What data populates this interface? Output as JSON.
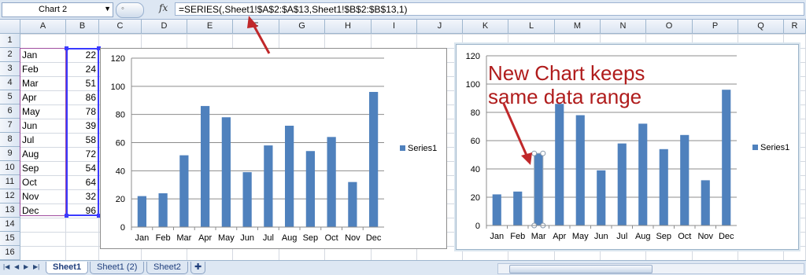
{
  "formula_bar": {
    "name_box": "Chart 2",
    "fx_icon": "fx",
    "formula": "=SERIES(,Sheet1!$A$2:$A$13,Sheet1!$B$2:$B$13,1)"
  },
  "columns": [
    "A",
    "B",
    "C",
    "D",
    "E",
    "F",
    "G",
    "H",
    "I",
    "J",
    "K",
    "L",
    "M",
    "N",
    "O",
    "P",
    "Q",
    "R"
  ],
  "rows": [
    "1",
    "2",
    "3",
    "4",
    "5",
    "6",
    "7",
    "8",
    "9",
    "10",
    "11",
    "12",
    "13",
    "14",
    "15",
    "16"
  ],
  "data": [
    {
      "month": "Jan",
      "value": "22"
    },
    {
      "month": "Feb",
      "value": "24"
    },
    {
      "month": "Mar",
      "value": "51"
    },
    {
      "month": "Apr",
      "value": "86"
    },
    {
      "month": "May",
      "value": "78"
    },
    {
      "month": "Jun",
      "value": "39"
    },
    {
      "month": "Jul",
      "value": "58"
    },
    {
      "month": "Aug",
      "value": "72"
    },
    {
      "month": "Sep",
      "value": "54"
    },
    {
      "month": "Oct",
      "value": "64"
    },
    {
      "month": "Nov",
      "value": "32"
    },
    {
      "month": "Dec",
      "value": "96"
    }
  ],
  "annotation": "New Chart keeps\nsame data range",
  "sheet_tabs": [
    "Sheet1",
    "Sheet1 (2)",
    "Sheet2"
  ],
  "active_tab": "Sheet1",
  "colors": {
    "bar": "#4f81bd",
    "annotation": "#b01c1c",
    "selection_border": "#3a3aff"
  },
  "chart_data": [
    {
      "type": "bar",
      "categories": [
        "Jan",
        "Feb",
        "Mar",
        "Apr",
        "May",
        "Jun",
        "Jul",
        "Aug",
        "Sep",
        "Oct",
        "Nov",
        "Dec"
      ],
      "series": [
        {
          "name": "Series1",
          "values": [
            22,
            24,
            51,
            86,
            78,
            39,
            58,
            72,
            54,
            64,
            32,
            96
          ]
        }
      ],
      "ylim": [
        0,
        120
      ],
      "yticks": [
        "0",
        "20",
        "40",
        "60",
        "80",
        "100",
        "120"
      ],
      "grid": true,
      "legend": "right"
    },
    {
      "type": "bar",
      "categories": [
        "Jan",
        "Feb",
        "Mar",
        "Apr",
        "May",
        "Jun",
        "Jul",
        "Aug",
        "Sep",
        "Oct",
        "Nov",
        "Dec"
      ],
      "series": [
        {
          "name": "Series1",
          "values": [
            22,
            24,
            51,
            86,
            78,
            39,
            58,
            72,
            54,
            64,
            32,
            96
          ]
        }
      ],
      "ylim": [
        0,
        120
      ],
      "yticks": [
        "0",
        "20",
        "40",
        "60",
        "80",
        "100",
        "120"
      ],
      "grid": true,
      "legend": "right",
      "selected_point": "Mar"
    }
  ]
}
